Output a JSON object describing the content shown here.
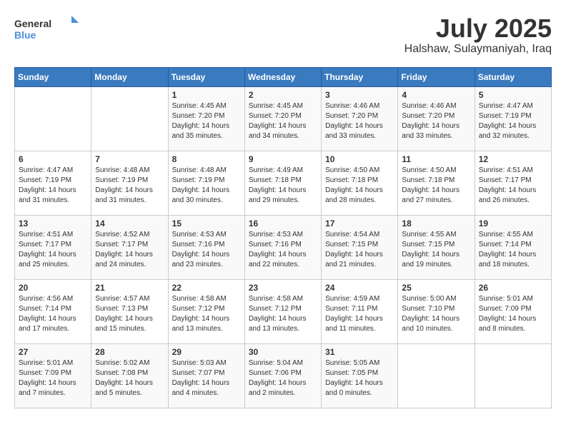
{
  "header": {
    "logo_general": "General",
    "logo_blue": "Blue",
    "month": "July 2025",
    "location": "Halshaw, Sulaymaniyah, Iraq"
  },
  "days_of_week": [
    "Sunday",
    "Monday",
    "Tuesday",
    "Wednesday",
    "Thursday",
    "Friday",
    "Saturday"
  ],
  "weeks": [
    [
      {
        "day": "",
        "info": ""
      },
      {
        "day": "",
        "info": ""
      },
      {
        "day": "1",
        "info": "Sunrise: 4:45 AM\nSunset: 7:20 PM\nDaylight: 14 hours and 35 minutes."
      },
      {
        "day": "2",
        "info": "Sunrise: 4:45 AM\nSunset: 7:20 PM\nDaylight: 14 hours and 34 minutes."
      },
      {
        "day": "3",
        "info": "Sunrise: 4:46 AM\nSunset: 7:20 PM\nDaylight: 14 hours and 33 minutes."
      },
      {
        "day": "4",
        "info": "Sunrise: 4:46 AM\nSunset: 7:20 PM\nDaylight: 14 hours and 33 minutes."
      },
      {
        "day": "5",
        "info": "Sunrise: 4:47 AM\nSunset: 7:19 PM\nDaylight: 14 hours and 32 minutes."
      }
    ],
    [
      {
        "day": "6",
        "info": "Sunrise: 4:47 AM\nSunset: 7:19 PM\nDaylight: 14 hours and 31 minutes."
      },
      {
        "day": "7",
        "info": "Sunrise: 4:48 AM\nSunset: 7:19 PM\nDaylight: 14 hours and 31 minutes."
      },
      {
        "day": "8",
        "info": "Sunrise: 4:48 AM\nSunset: 7:19 PM\nDaylight: 14 hours and 30 minutes."
      },
      {
        "day": "9",
        "info": "Sunrise: 4:49 AM\nSunset: 7:18 PM\nDaylight: 14 hours and 29 minutes."
      },
      {
        "day": "10",
        "info": "Sunrise: 4:50 AM\nSunset: 7:18 PM\nDaylight: 14 hours and 28 minutes."
      },
      {
        "day": "11",
        "info": "Sunrise: 4:50 AM\nSunset: 7:18 PM\nDaylight: 14 hours and 27 minutes."
      },
      {
        "day": "12",
        "info": "Sunrise: 4:51 AM\nSunset: 7:17 PM\nDaylight: 14 hours and 26 minutes."
      }
    ],
    [
      {
        "day": "13",
        "info": "Sunrise: 4:51 AM\nSunset: 7:17 PM\nDaylight: 14 hours and 25 minutes."
      },
      {
        "day": "14",
        "info": "Sunrise: 4:52 AM\nSunset: 7:17 PM\nDaylight: 14 hours and 24 minutes."
      },
      {
        "day": "15",
        "info": "Sunrise: 4:53 AM\nSunset: 7:16 PM\nDaylight: 14 hours and 23 minutes."
      },
      {
        "day": "16",
        "info": "Sunrise: 4:53 AM\nSunset: 7:16 PM\nDaylight: 14 hours and 22 minutes."
      },
      {
        "day": "17",
        "info": "Sunrise: 4:54 AM\nSunset: 7:15 PM\nDaylight: 14 hours and 21 minutes."
      },
      {
        "day": "18",
        "info": "Sunrise: 4:55 AM\nSunset: 7:15 PM\nDaylight: 14 hours and 19 minutes."
      },
      {
        "day": "19",
        "info": "Sunrise: 4:55 AM\nSunset: 7:14 PM\nDaylight: 14 hours and 18 minutes."
      }
    ],
    [
      {
        "day": "20",
        "info": "Sunrise: 4:56 AM\nSunset: 7:14 PM\nDaylight: 14 hours and 17 minutes."
      },
      {
        "day": "21",
        "info": "Sunrise: 4:57 AM\nSunset: 7:13 PM\nDaylight: 14 hours and 15 minutes."
      },
      {
        "day": "22",
        "info": "Sunrise: 4:58 AM\nSunset: 7:12 PM\nDaylight: 14 hours and 13 minutes."
      },
      {
        "day": "23",
        "info": "Sunrise: 4:58 AM\nSunset: 7:12 PM\nDaylight: 14 hours and 13 minutes."
      },
      {
        "day": "24",
        "info": "Sunrise: 4:59 AM\nSunset: 7:11 PM\nDaylight: 14 hours and 11 minutes."
      },
      {
        "day": "25",
        "info": "Sunrise: 5:00 AM\nSunset: 7:10 PM\nDaylight: 14 hours and 10 minutes."
      },
      {
        "day": "26",
        "info": "Sunrise: 5:01 AM\nSunset: 7:09 PM\nDaylight: 14 hours and 8 minutes."
      }
    ],
    [
      {
        "day": "27",
        "info": "Sunrise: 5:01 AM\nSunset: 7:09 PM\nDaylight: 14 hours and 7 minutes."
      },
      {
        "day": "28",
        "info": "Sunrise: 5:02 AM\nSunset: 7:08 PM\nDaylight: 14 hours and 5 minutes."
      },
      {
        "day": "29",
        "info": "Sunrise: 5:03 AM\nSunset: 7:07 PM\nDaylight: 14 hours and 4 minutes."
      },
      {
        "day": "30",
        "info": "Sunrise: 5:04 AM\nSunset: 7:06 PM\nDaylight: 14 hours and 2 minutes."
      },
      {
        "day": "31",
        "info": "Sunrise: 5:05 AM\nSunset: 7:05 PM\nDaylight: 14 hours and 0 minutes."
      },
      {
        "day": "",
        "info": ""
      },
      {
        "day": "",
        "info": ""
      }
    ]
  ]
}
